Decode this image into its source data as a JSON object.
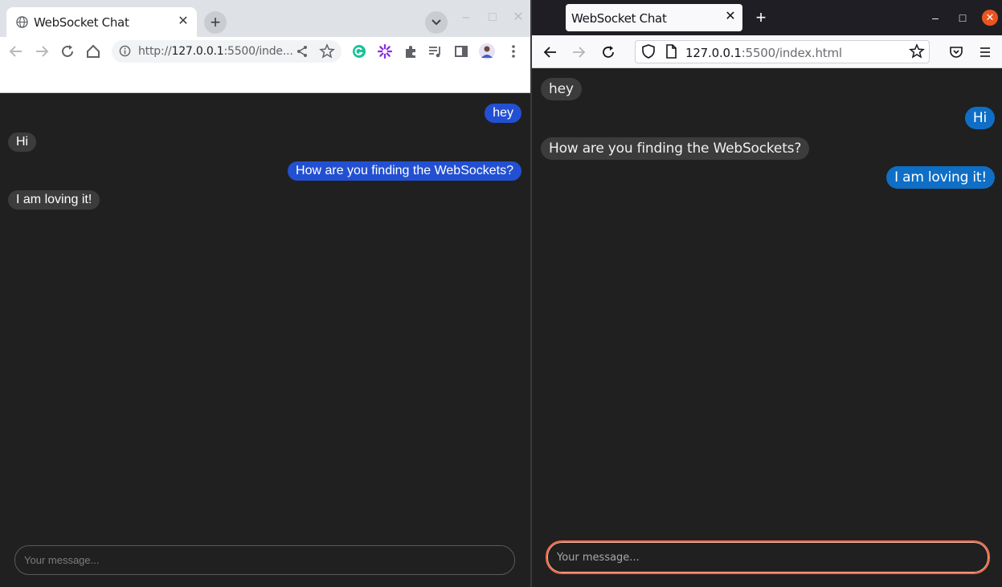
{
  "left_window": {
    "browser": "chrome",
    "tab": {
      "title": "WebSocket Chat",
      "close_glyph": "✕"
    },
    "new_tab_glyph": "+",
    "window_controls": {
      "minimize": "–",
      "maximize": "□",
      "close": "✕"
    },
    "address_bar": {
      "url_prefix": "http://",
      "url_host": "127.0.0.1",
      "url_rest": ":5500/inde..."
    },
    "messages": [
      {
        "text": "hey",
        "side": "right"
      },
      {
        "text": "Hi",
        "side": "left"
      },
      {
        "text": "How are you finding the WebSockets?",
        "side": "right"
      },
      {
        "text": "I am loving it!",
        "side": "left"
      }
    ],
    "input": {
      "placeholder": "Your message...",
      "value": ""
    },
    "colors": {
      "outgoing": "#2350d2",
      "incoming": "#3c3c3c",
      "background": "#202020"
    }
  },
  "right_window": {
    "browser": "firefox",
    "tab": {
      "title": "WebSocket Chat",
      "close_glyph": "✕"
    },
    "new_tab_glyph": "+",
    "window_controls": {
      "minimize": "–",
      "maximize": "□",
      "close": "✕"
    },
    "address_bar": {
      "url_host": "127.0.0.1",
      "url_rest": ":5500/index.html"
    },
    "messages": [
      {
        "text": "hey",
        "side": "left"
      },
      {
        "text": "Hi",
        "side": "right"
      },
      {
        "text": "How are you finding the WebSockets?",
        "side": "left"
      },
      {
        "text": "I am loving it!",
        "side": "right"
      }
    ],
    "input": {
      "placeholder": "Your message...",
      "value": ""
    },
    "colors": {
      "outgoing": "#0f6fc6",
      "incoming": "#3c3c3c",
      "focus_ring": "#f06a4a"
    }
  }
}
